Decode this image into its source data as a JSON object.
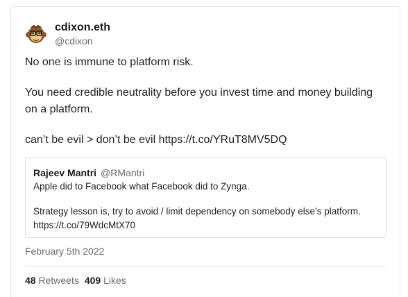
{
  "author": {
    "display_name": "cdixon.eth",
    "handle": "@cdixon",
    "avatar_icon": "monkey-avatar-icon"
  },
  "tweet": {
    "paragraphs": [
      "No one is immune to platform risk.",
      "You need credible neutrality before you invest time and money building on a platform.",
      "can’t be evil > don’t be evil"
    ],
    "link": "https://t.co/YRuT8MV5DQ"
  },
  "quoted": {
    "display_name": "Rajeev Mantri",
    "handle": "@RMantri",
    "line1": "Apple did to Facebook what Facebook did to Zynga.",
    "line2": "Strategy lesson is, try to avoid / limit dependency on somebody else’s platform.",
    "link": "https://t.co/79WdcMtX70"
  },
  "date": "February 5th 2022",
  "stats": {
    "retweets_count": "48",
    "retweets_label": "Retweets",
    "likes_count": "409",
    "likes_label": "Likes"
  }
}
